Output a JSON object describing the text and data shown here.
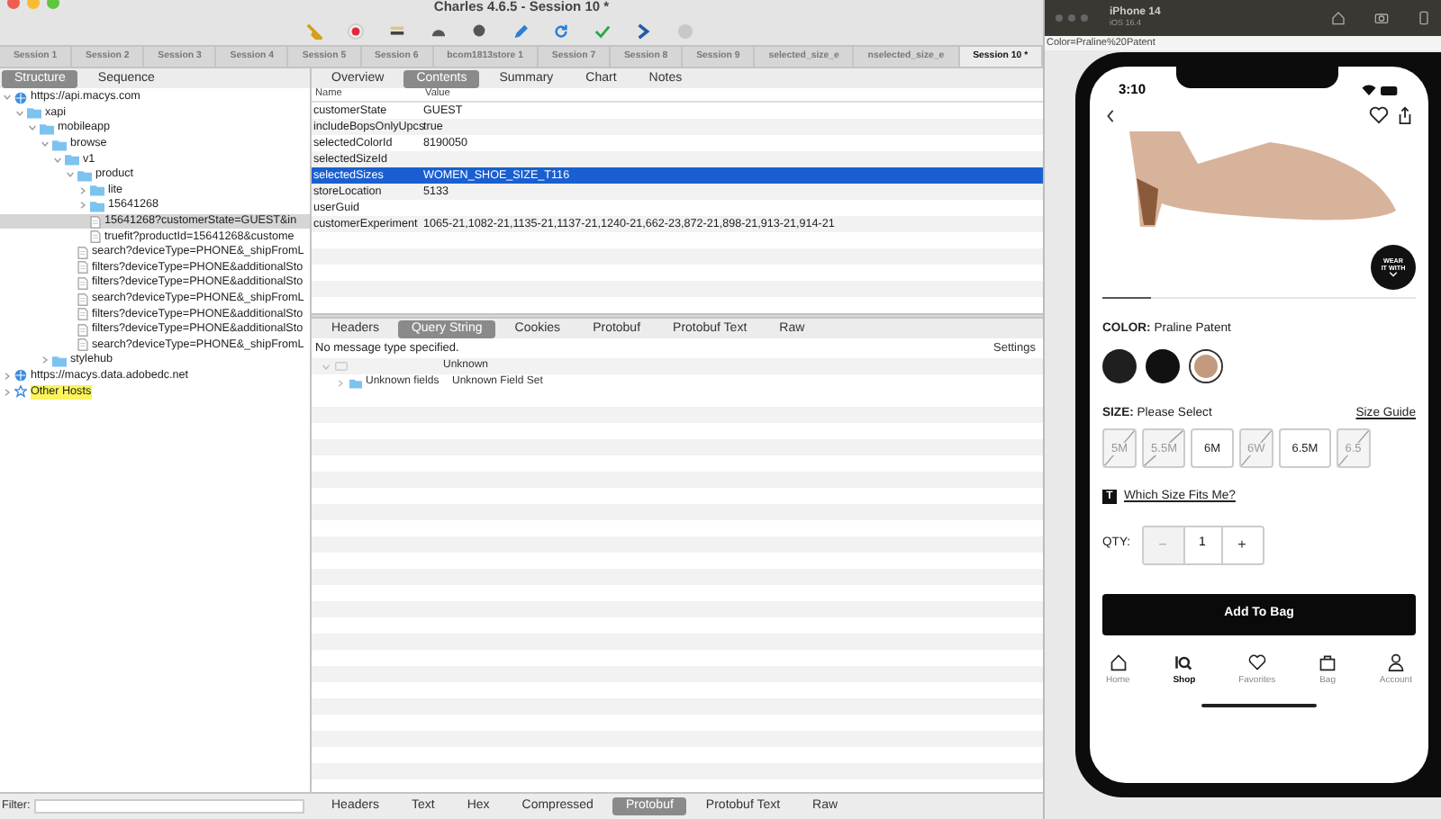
{
  "window": {
    "title": "Charles 4.6.5 - Session 10 *"
  },
  "session_tabs": [
    {
      "label": "Session 1",
      "selected": false
    },
    {
      "label": "Session 2",
      "selected": false
    },
    {
      "label": "Session 3",
      "selected": false
    },
    {
      "label": "Session 4",
      "selected": false
    },
    {
      "label": "Session 5",
      "selected": false
    },
    {
      "label": "Session 6",
      "selected": false
    },
    {
      "label": "bcom1813store 1",
      "selected": false
    },
    {
      "label": "Session 7",
      "selected": false
    },
    {
      "label": "Session 8",
      "selected": false
    },
    {
      "label": "Session 9",
      "selected": false
    },
    {
      "label": "selected_size_e",
      "selected": false
    },
    {
      "label": "nselected_size_e",
      "selected": false
    },
    {
      "label": "Session 10 *",
      "selected": true
    }
  ],
  "left_tabs": [
    {
      "label": "Structure",
      "selected": true
    },
    {
      "label": "Sequence",
      "selected": false
    }
  ],
  "tree": [
    {
      "kind": "host",
      "label": "https://api.macys.com",
      "expanded": true,
      "selected": false,
      "children": [
        {
          "kind": "folder",
          "label": "xapi",
          "expanded": true,
          "selected": false,
          "children": [
            {
              "kind": "folder",
              "label": "mobileapp",
              "expanded": true,
              "selected": false,
              "children": [
                {
                  "kind": "folder",
                  "label": "browse",
                  "expanded": true,
                  "selected": false,
                  "children": [
                    {
                      "kind": "folder",
                      "label": "v1",
                      "expanded": true,
                      "selected": false,
                      "children": [
                        {
                          "kind": "folder",
                          "label": "product",
                          "expanded": true,
                          "selected": false,
                          "children": [
                            {
                              "kind": "folder",
                              "label": "lite",
                              "expanded": false,
                              "selected": false
                            },
                            {
                              "kind": "folder",
                              "label": "15641268",
                              "expanded": false,
                              "selected": false
                            },
                            {
                              "kind": "file",
                              "label": "15641268?customerState=GUEST&in",
                              "selected": true
                            },
                            {
                              "kind": "file",
                              "label": "truefit?productId=15641268&custome",
                              "selected": false
                            }
                          ]
                        },
                        {
                          "kind": "file",
                          "label": "search?deviceType=PHONE&_shipFromL",
                          "selected": false
                        },
                        {
                          "kind": "file",
                          "label": "filters?deviceType=PHONE&additionalSto",
                          "selected": false
                        },
                        {
                          "kind": "file",
                          "label": "filters?deviceType=PHONE&additionalSto",
                          "selected": false
                        },
                        {
                          "kind": "file",
                          "label": "search?deviceType=PHONE&_shipFromL",
                          "selected": false
                        },
                        {
                          "kind": "file",
                          "label": "filters?deviceType=PHONE&additionalSto",
                          "selected": false
                        },
                        {
                          "kind": "file",
                          "label": "filters?deviceType=PHONE&additionalSto",
                          "selected": false
                        },
                        {
                          "kind": "file",
                          "label": "search?deviceType=PHONE&_shipFromL",
                          "selected": false
                        }
                      ]
                    }
                  ]
                },
                {
                  "kind": "folder",
                  "label": "stylehub",
                  "expanded": false,
                  "selected": false
                }
              ]
            }
          ]
        }
      ]
    },
    {
      "kind": "host",
      "label": "https://macys.data.adobedc.net",
      "expanded": false,
      "selected": false
    },
    {
      "kind": "other",
      "label": "Other Hosts",
      "selected": false
    }
  ],
  "filter": {
    "label": "Filter:"
  },
  "detail_tabs": [
    {
      "label": "Overview",
      "selected": false
    },
    {
      "label": "Contents",
      "selected": true
    },
    {
      "label": "Summary",
      "selected": false
    },
    {
      "label": "Chart",
      "selected": false
    },
    {
      "label": "Notes",
      "selected": false
    }
  ],
  "table": {
    "columns": [
      "Name",
      "Value"
    ],
    "rows": [
      {
        "name": "customerState",
        "value": "GUEST",
        "selected": false
      },
      {
        "name": "includeBopsOnlyUpcs",
        "value": "true",
        "selected": false
      },
      {
        "name": "selectedColorId",
        "value": "8190050",
        "selected": false
      },
      {
        "name": "selectedSizeId",
        "value": "",
        "selected": false
      },
      {
        "name": "selectedSizes",
        "value": "WOMEN_SHOE_SIZE_T116",
        "selected": true
      },
      {
        "name": "storeLocation",
        "value": "5133",
        "selected": false
      },
      {
        "name": "userGuid",
        "value": "",
        "selected": false
      },
      {
        "name": "customerExperiment",
        "value": "1065-21,1082-21,1135-21,1137-21,1240-21,662-23,872-21,898-21,913-21,914-21",
        "selected": false
      }
    ]
  },
  "request_tabs": [
    {
      "label": "Headers",
      "selected": false
    },
    {
      "label": "Query String",
      "selected": true
    },
    {
      "label": "Cookies",
      "selected": false
    },
    {
      "label": "Protobuf",
      "selected": false
    },
    {
      "label": "Protobuf Text",
      "selected": false
    },
    {
      "label": "Raw",
      "selected": false
    }
  ],
  "message": "No message type specified.",
  "settings_button": "Settings",
  "proto_tree": {
    "header": "Unknown",
    "rows": [
      {
        "name": "Unknown fields",
        "value": "Unknown Field Set"
      }
    ]
  },
  "bottom_tabs": [
    {
      "label": "Headers",
      "selected": false
    },
    {
      "label": "Text",
      "selected": false
    },
    {
      "label": "Hex",
      "selected": false
    },
    {
      "label": "Compressed",
      "selected": false
    },
    {
      "label": "Protobuf",
      "selected": true
    },
    {
      "label": "Protobuf Text",
      "selected": false
    },
    {
      "label": "Raw",
      "selected": false
    }
  ],
  "simulator": {
    "device": "iPhone 14",
    "os": "iOS 16.4",
    "url": "Color=Praline%20Patent"
  },
  "phone": {
    "time": "3:10",
    "wear_button": [
      "WEAR",
      "IT WITH"
    ],
    "color_label": "COLOR:",
    "color_value": "Praline Patent",
    "swatches": [
      {
        "color": "#1f1f1f",
        "selected": false
      },
      {
        "color": "#111111",
        "selected": false
      },
      {
        "color": "#c49a7e",
        "selected": true
      }
    ],
    "size_label": "SIZE:",
    "size_value": "Please Select",
    "size_guide": "Size Guide",
    "sizes": [
      {
        "label": "5M",
        "disabled": true
      },
      {
        "label": "5.5M",
        "disabled": true
      },
      {
        "label": "6M",
        "disabled": false
      },
      {
        "label": "6W",
        "disabled": true
      },
      {
        "label": "6.5M",
        "disabled": false
      },
      {
        "label": "6.5",
        "disabled": true
      }
    ],
    "fit_badge": "T",
    "fit_link": "Which Size Fits Me?",
    "qty_label": "QTY:",
    "qty_minus": "−",
    "qty": "1",
    "qty_plus": "+",
    "add_button": "Add To Bag",
    "nav": [
      {
        "kind": "home",
        "label": "Home",
        "selected": false
      },
      {
        "kind": "shop",
        "label": "Shop",
        "selected": true
      },
      {
        "kind": "favorites",
        "label": "Favorites",
        "selected": false
      },
      {
        "kind": "bag",
        "label": "Bag",
        "selected": false
      },
      {
        "kind": "account",
        "label": "Account",
        "selected": false
      }
    ]
  }
}
